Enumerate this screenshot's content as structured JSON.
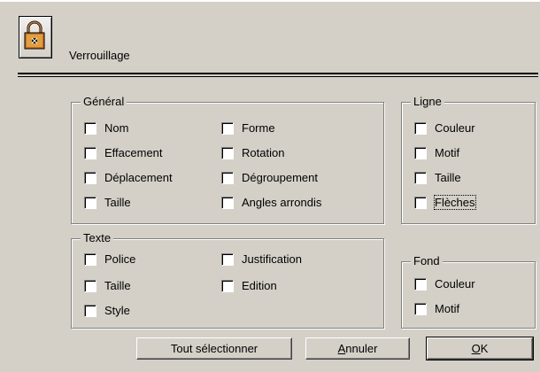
{
  "header": {
    "title": "Verrouillage",
    "icon": "lock-icon"
  },
  "groups": {
    "general": {
      "title": "Général",
      "left": [
        "Nom",
        "Effacement",
        "Déplacement",
        "Taille"
      ],
      "right": [
        "Forme",
        "Rotation",
        "Dégroupement",
        "Angles arrondis"
      ]
    },
    "texte": {
      "title": "Texte",
      "left": [
        "Police",
        "Taille",
        "Style"
      ],
      "right": [
        "Justification",
        "Edition"
      ]
    },
    "ligne": {
      "title": "Ligne",
      "items": [
        "Couleur",
        "Motif",
        "Taille",
        "Flèches"
      ]
    },
    "fond": {
      "title": "Fond",
      "items": [
        "Couleur",
        "Motif"
      ]
    }
  },
  "buttons": {
    "select_all": "Tout sélectionner",
    "cancel_first": "A",
    "cancel_rest": "nnuler",
    "ok_first": "O",
    "ok_rest": "K"
  },
  "colors": {
    "face": "#d4d0c8",
    "shadow": "#808080",
    "highlight": "#ffffff"
  }
}
